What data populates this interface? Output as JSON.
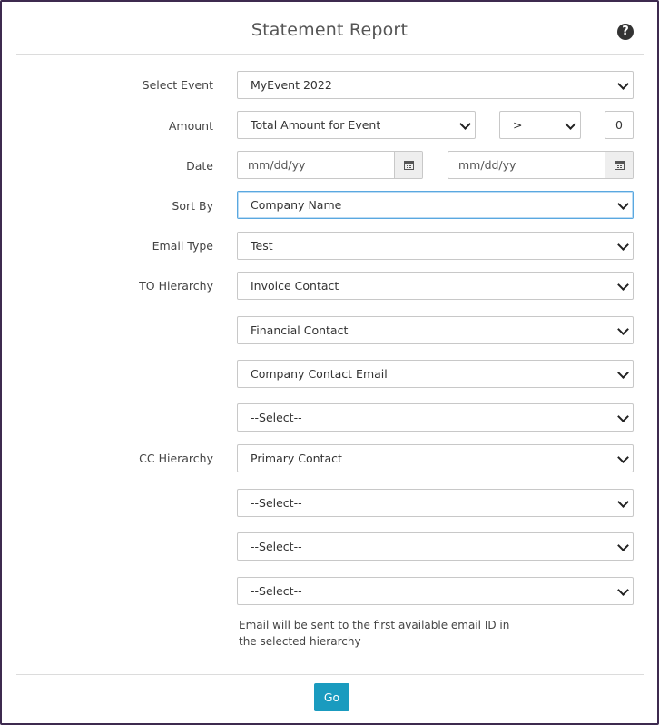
{
  "header": {
    "title": "Statement Report",
    "help_glyph": "?"
  },
  "fields": {
    "select_event": {
      "label": "Select Event",
      "value": "MyEvent 2022"
    },
    "amount": {
      "label": "Amount",
      "type_value": "Total Amount for Event",
      "operator_value": ">",
      "amount_value": "0"
    },
    "date": {
      "label": "Date",
      "from_placeholder": "mm/dd/yy",
      "to_placeholder": "mm/dd/yy"
    },
    "sort_by": {
      "label": "Sort By",
      "value": "Company Name"
    },
    "email_type": {
      "label": "Email Type",
      "value": "Test"
    },
    "to_hierarchy": {
      "label": "TO Hierarchy",
      "values": [
        "Invoice Contact",
        "Financial Contact",
        "Company Contact Email",
        "--Select--"
      ]
    },
    "cc_hierarchy": {
      "label": "CC Hierarchy",
      "values": [
        "Primary Contact",
        "--Select--",
        "--Select--",
        "--Select--"
      ]
    }
  },
  "note": "Email will be sent to the first available email ID in the selected hierarchy",
  "footer": {
    "go_label": "Go"
  },
  "colors": {
    "accent": "#1a9bbf",
    "frame": "#3d2a4f",
    "focus": "#5aa8e0"
  },
  "icons": {
    "help": "question-circle-icon",
    "calendar": "calendar-icon",
    "dropdown": "chevron-down-icon"
  }
}
